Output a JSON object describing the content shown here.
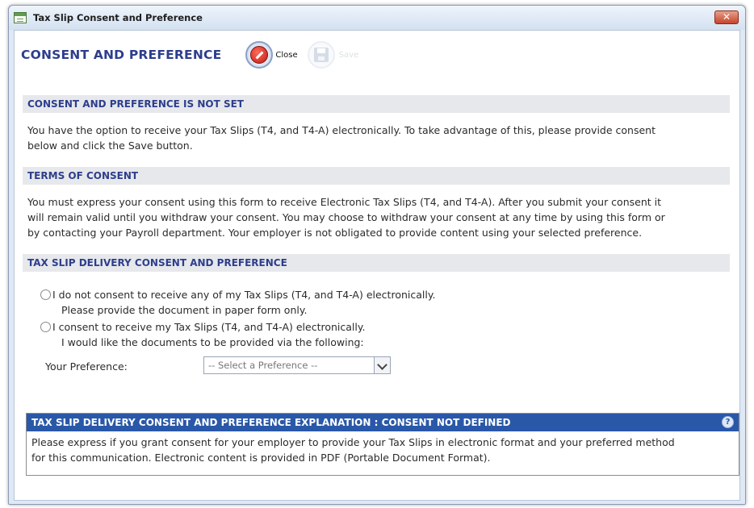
{
  "window": {
    "title": "Tax Slip Consent and Preference",
    "close_glyph": "✕"
  },
  "toolbar": {
    "page_title": "CONSENT AND PREFERENCE",
    "close_label": "Close",
    "save_label": "Save"
  },
  "sections": {
    "status": {
      "heading": "CONSENT AND PREFERENCE IS NOT SET",
      "text_line1": "You have the option to receive your Tax Slips (T4, and T4-A) electronically.  To take advantage of this, please provide consent",
      "text_line2": "below and click the Save button."
    },
    "terms": {
      "heading": "TERMS OF CONSENT",
      "text_line1": "You must express your consent using this form to receive Electronic Tax Slips (T4, and T4-A).  After you submit your consent it",
      "text_line2": "will remain valid until you withdraw your consent.  You may choose to withdraw your consent at any time by using this form or",
      "text_line3": "by contacting your Payroll department.  Your employer is not obligated to provide content using your selected preference."
    },
    "delivery": {
      "heading": "TAX SLIP DELIVERY CONSENT AND PREFERENCE",
      "option_no_consent": "I do not consent to receive any of my Tax Slips (T4, and T4-A) electronically.",
      "option_no_consent_sub": "Please provide the document in paper form only.",
      "option_consent": "I consent to receive my Tax Slips (T4, and T4-A) electronically.",
      "option_consent_sub": "I would like the documents to be provided via the following:",
      "preference_label": "Your Preference:",
      "preference_value": "-- Select a Preference --"
    }
  },
  "explanation": {
    "heading": "TAX SLIP DELIVERY CONSENT AND PREFERENCE EXPLANATION : CONSENT NOT DEFINED",
    "help_glyph": "?",
    "text_line1": "Please express if you grant consent for your employer to provide your Tax Slips in electronic format and your preferred method",
    "text_line2": "for this communication.  Electronic content is provided in PDF (Portable Document Format)."
  },
  "colors": {
    "heading_blue": "#2d3e8c",
    "explain_header_bg": "#2a58a8",
    "section_bar_bg": "#e7e8ec"
  }
}
